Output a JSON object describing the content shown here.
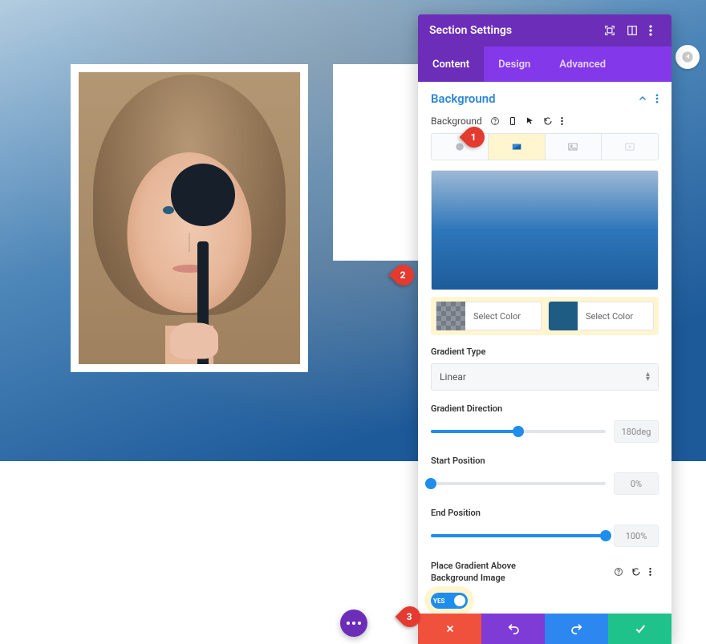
{
  "panel": {
    "title": "Section Settings",
    "tabs": [
      "Content",
      "Design",
      "Advanced"
    ],
    "active_tab": 0
  },
  "section": {
    "title": "Background",
    "row_label": "Background"
  },
  "color_picker": {
    "left_label": "Select Color",
    "right_label": "Select Color"
  },
  "gradient_type": {
    "label": "Gradient Type",
    "value": "Linear"
  },
  "gradient_direction": {
    "label": "Gradient Direction",
    "value": "180deg",
    "percent": 50
  },
  "start_position": {
    "label": "Start Position",
    "value": "0%",
    "percent": 0
  },
  "end_position": {
    "label": "End Position",
    "value": "100%",
    "percent": 100
  },
  "place_above": {
    "label": "Place Gradient Above Background Image",
    "toggle_text": "YES"
  },
  "callouts": {
    "one": "1",
    "two": "2",
    "three": "3"
  }
}
